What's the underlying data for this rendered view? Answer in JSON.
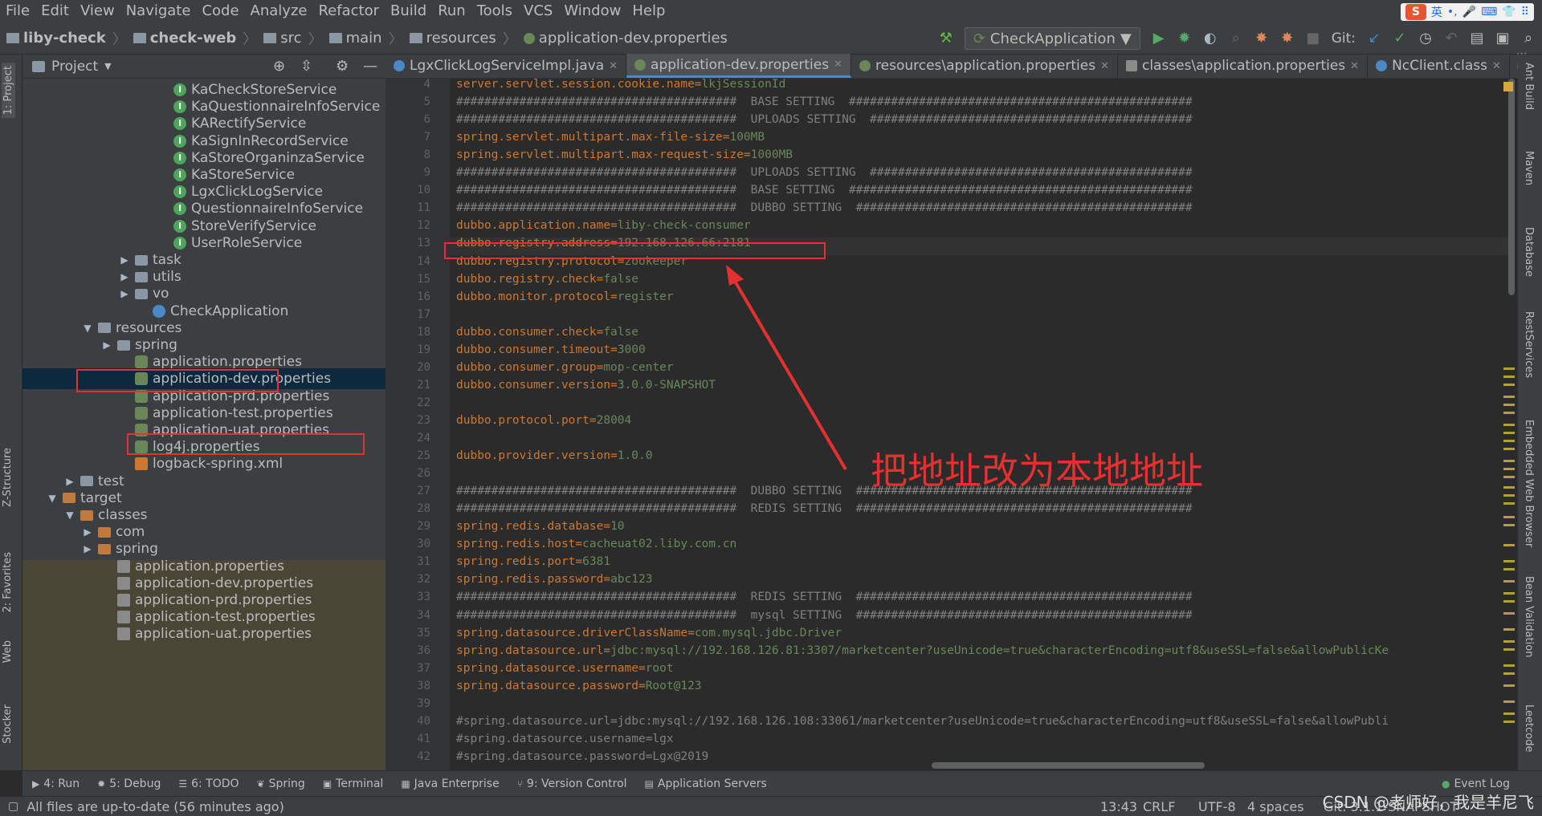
{
  "menu": [
    "File",
    "Edit",
    "View",
    "Navigate",
    "Code",
    "Analyze",
    "Refactor",
    "Build",
    "Run",
    "Tools",
    "VCS",
    "Window",
    "Help"
  ],
  "ime": {
    "lang": "英"
  },
  "breadcrumb": [
    "liby-check",
    "check-web",
    "src",
    "main",
    "resources",
    "application-dev.properties"
  ],
  "toolbar": {
    "run_config": "CheckApplication",
    "git_label": "Git:"
  },
  "project_panel": {
    "title": "Project"
  },
  "tree": [
    {
      "label": "KaCheckStoreService",
      "icon": "interface-icon"
    },
    {
      "label": "KaQuestionnaireInfoService",
      "icon": "interface-icon"
    },
    {
      "label": "KARectifyService",
      "icon": "interface-icon"
    },
    {
      "label": "KaSignInRecordService",
      "icon": "interface-icon"
    },
    {
      "label": "KaStoreOrganinzaService",
      "icon": "interface-icon"
    },
    {
      "label": "KaStoreService",
      "icon": "interface-icon"
    },
    {
      "label": "LgxClickLogService",
      "icon": "interface-icon"
    },
    {
      "label": "QuestionnaireInfoService",
      "icon": "interface-icon"
    },
    {
      "label": "StoreVerifyService",
      "icon": "interface-icon"
    },
    {
      "label": "UserRoleService",
      "icon": "interface-icon"
    },
    {
      "label": "task",
      "icon": "folder-icon"
    },
    {
      "label": "utils",
      "icon": "folder-icon"
    },
    {
      "label": "vo",
      "icon": "folder-icon"
    },
    {
      "label": "CheckApplication",
      "icon": "spring-boot-icon"
    },
    {
      "label": "resources",
      "icon": "resources-folder-icon"
    },
    {
      "label": "spring",
      "icon": "folder-icon"
    },
    {
      "label": "application.properties",
      "icon": "properties-icon"
    },
    {
      "label": "application-dev.properties",
      "icon": "properties-icon"
    },
    {
      "label": "application-prd.properties",
      "icon": "properties-icon"
    },
    {
      "label": "application-test.properties",
      "icon": "properties-icon"
    },
    {
      "label": "application-uat.properties",
      "icon": "properties-icon"
    },
    {
      "label": "log4j.properties",
      "icon": "properties-icon"
    },
    {
      "label": "logback-spring.xml",
      "icon": "xml-icon"
    },
    {
      "label": "test",
      "icon": "folder-icon"
    },
    {
      "label": "target",
      "icon": "excluded-folder-icon"
    },
    {
      "label": "classes",
      "icon": "excluded-folder-icon"
    },
    {
      "label": "com",
      "icon": "excluded-folder-icon"
    },
    {
      "label": "spring",
      "icon": "excluded-folder-icon"
    },
    {
      "label": "application.properties",
      "icon": "properties-icon"
    },
    {
      "label": "application-dev.properties",
      "icon": "properties-icon"
    },
    {
      "label": "application-prd.properties",
      "icon": "properties-icon"
    },
    {
      "label": "application-test.properties",
      "icon": "properties-icon"
    },
    {
      "label": "application-uat.properties",
      "icon": "properties-icon"
    }
  ],
  "editor_tabs": [
    "LgxClickLogServiceImpl.java",
    "application-dev.properties",
    "resources\\application.properties",
    "classes\\application.properties",
    "NcClient.class"
  ],
  "code": {
    "line_numbers": [
      "4",
      "5",
      "6",
      "7",
      "8",
      "9",
      "10",
      "11",
      "12",
      "13",
      "14",
      "15",
      "16",
      "17",
      "18",
      "19",
      "20",
      "21",
      "22",
      "23",
      "24",
      "25",
      "26",
      "27",
      "28",
      "29",
      "30",
      "31",
      "32",
      "33",
      "34",
      "35",
      "36",
      "37",
      "38",
      "39",
      "40",
      "41",
      "42"
    ],
    "lines": [
      {
        "key": "server.servlet.session.cookie.name=",
        "val": "lkjSessionId"
      },
      {
        "comment": "########################################  BASE SETTING  #################################################"
      },
      {
        "comment": "########################################  UPLOADS SETTING  ##############################################"
      },
      {
        "key": "spring.servlet.multipart.max-file-size=",
        "val": "100MB"
      },
      {
        "key": "spring.servlet.multipart.max-request-size=",
        "val": "1000MB"
      },
      {
        "comment": "########################################  UPLOADS SETTING  ##############################################"
      },
      {
        "comment": "########################################  BASE SETTING  #################################################"
      },
      {
        "comment": "########################################  DUBBO SETTING  ################################################"
      },
      {
        "key": "dubbo.application.name=",
        "val": "liby-check-consumer"
      },
      {
        "key": "dubbo.registry.address=",
        "val": "192.168.126.66:2181"
      },
      {
        "key": "dubbo.registry.protocol=",
        "val": "zookeeper"
      },
      {
        "key": "dubbo.registry.check=",
        "val": "false"
      },
      {
        "key": "dubbo.monitor.protocol=",
        "val": "register"
      },
      {},
      {
        "key": "dubbo.consumer.check=",
        "val": "false"
      },
      {
        "key": "dubbo.consumer.timeout=",
        "val": "3000"
      },
      {
        "key": "dubbo.consumer.group=",
        "val": "mop-center"
      },
      {
        "key": "dubbo.consumer.version=",
        "val": "3.0.0-SNAPSHOT"
      },
      {},
      {
        "key": "dubbo.protocol.port=",
        "val": "28004"
      },
      {},
      {
        "key": "dubbo.provider.version=",
        "val": "1.0.0"
      },
      {},
      {
        "comment": "########################################  DUBBO SETTING  ################################################"
      },
      {
        "comment": "########################################  REDIS SETTING  ################################################"
      },
      {
        "key": "spring.redis.database=",
        "val": "10"
      },
      {
        "key": "spring.redis.host=",
        "val": "cacheuat02.liby.com.cn"
      },
      {
        "key": "spring.redis.port=",
        "val": "6381"
      },
      {
        "key": "spring.redis.password=",
        "val": "abc123"
      },
      {
        "comment": "########################################  REDIS SETTING  ################################################"
      },
      {
        "comment": "########################################  mysql SETTING  ################################################"
      },
      {
        "key": "spring.datasource.driverClassName=",
        "val": "com.mysql.jdbc.Driver"
      },
      {
        "key": "spring.datasource.url=",
        "val": "jdbc:mysql://192.168.126.81:3307/marketcenter?useUnicode=true&characterEncoding=utf8&useSSL=false&allowPublicKe"
      },
      {
        "key": "spring.datasource.username=",
        "val": "root"
      },
      {
        "key": "spring.datasource.password=",
        "val": "Root@123"
      },
      {},
      {
        "comment": "#spring.datasource.url=jdbc:mysql://192.168.126.108:33061/marketcenter?useUnicode=true&characterEncoding=utf8&useSSL=false&allowPubli"
      },
      {
        "comment": "#spring.datasource.username=lgx"
      },
      {
        "comment": "#spring.datasource.password=Lgx@2019"
      }
    ]
  },
  "annotation": {
    "text": "把地址改为本地地址"
  },
  "right_tools": [
    "Ant Build",
    "Maven",
    "Database",
    "RestServices",
    "Embedded Web Browser",
    "Bean Validation",
    "Leetcode"
  ],
  "left_tools": [
    "1: Project",
    "Z-Structure",
    "2: Favorites",
    "Web",
    "Stocker"
  ],
  "bottom_tools": [
    "4: Run",
    "5: Debug",
    "6: TODO",
    "Spring",
    "Terminal",
    "Java Enterprise",
    "9: Version Control",
    "Application Servers",
    "Event Log"
  ],
  "status": {
    "message": "All files are up-to-date (56 minutes ago)",
    "position": "13:43",
    "line_sep": "CRLF",
    "encoding": "UTF-8",
    "indent": "4 spaces",
    "git": "Git: 3.1.1-SNAPSHOT"
  },
  "watermark": "CSDN @老师好，我是羊尼飞"
}
